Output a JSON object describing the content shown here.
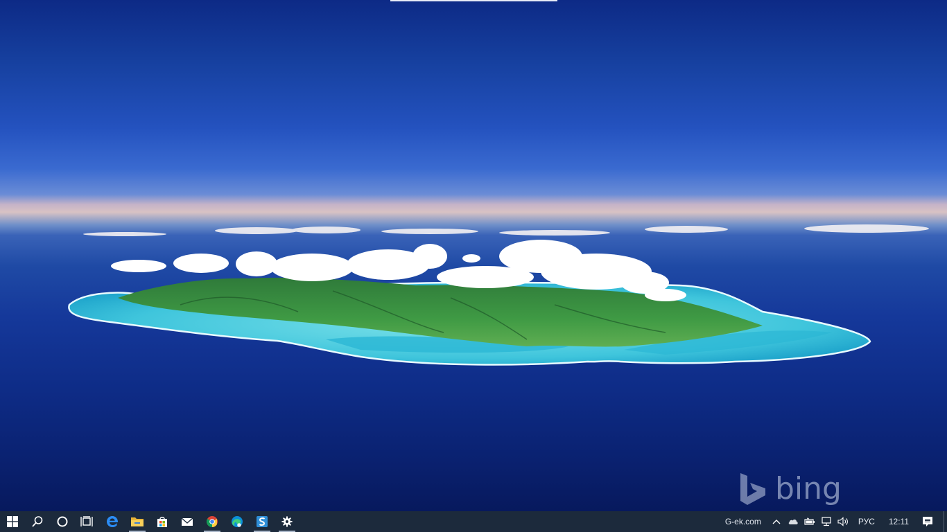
{
  "wallpaper": {
    "brand": "bing"
  },
  "taskbar": {
    "buttons": [
      {
        "name": "start-button",
        "icon": "windows-logo-icon",
        "running": false
      },
      {
        "name": "search-button",
        "icon": "search-icon",
        "running": false
      },
      {
        "name": "cortana-button",
        "icon": "cortana-circle-icon",
        "running": false
      },
      {
        "name": "task-view-button",
        "icon": "task-view-icon",
        "running": false
      },
      {
        "name": "edge-legacy-app",
        "icon": "edge-legacy-icon",
        "running": false
      },
      {
        "name": "file-explorer-app",
        "icon": "folder-icon",
        "running": true
      },
      {
        "name": "store-app",
        "icon": "store-bag-icon",
        "running": false
      },
      {
        "name": "mail-app",
        "icon": "mail-icon",
        "running": false
      },
      {
        "name": "chrome-app",
        "icon": "chrome-icon",
        "running": true
      },
      {
        "name": "edge-app",
        "icon": "edge-icon",
        "running": false
      },
      {
        "name": "sway-app",
        "icon": "s-app-icon",
        "running": true
      },
      {
        "name": "settings-app",
        "icon": "gear-icon",
        "running": true
      }
    ],
    "tray": {
      "site": "G-ek.com",
      "language": "РУС",
      "time": "12:11",
      "icons": [
        "chevron-up-icon",
        "onedrive-cloud-icon",
        "battery-icon",
        "network-icon",
        "volume-icon",
        "action-center-icon"
      ]
    },
    "colors": {
      "background": "#1c2a3c",
      "running_indicator": "#a9b6c8"
    }
  }
}
